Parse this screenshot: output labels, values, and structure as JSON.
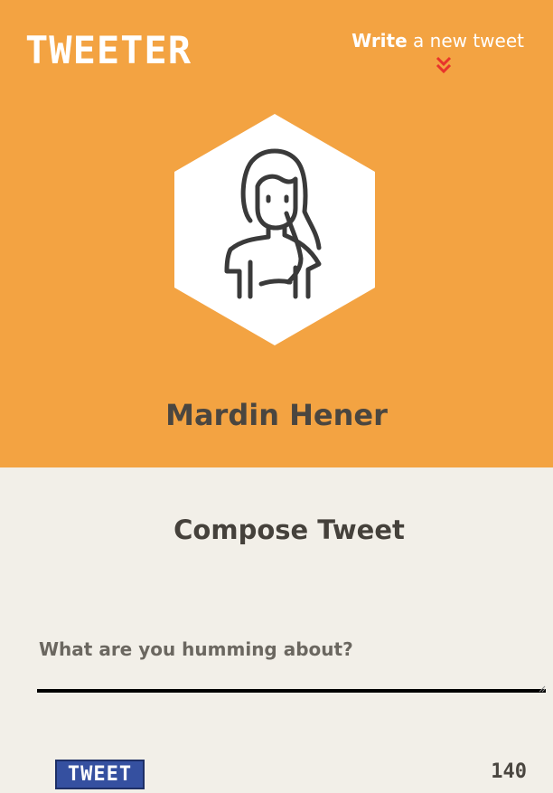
{
  "header": {
    "logo": "TWEETER",
    "write_link_bold": "Write",
    "write_link_rest": " a new tweet",
    "chevron_icon": "double-chevron-down-icon",
    "chevron_color": "#e8332b"
  },
  "profile": {
    "avatar_icon": "woman-avatar-icon",
    "name": "Mardin Hener"
  },
  "compose": {
    "title": "Compose Tweet",
    "placeholder": "What are you humming about?",
    "value": "",
    "submit_label": "TWEET",
    "char_count": "140"
  },
  "colors": {
    "hero_bg": "#f3a342",
    "page_bg": "#f2efe8",
    "button_bg": "#3550a0"
  }
}
